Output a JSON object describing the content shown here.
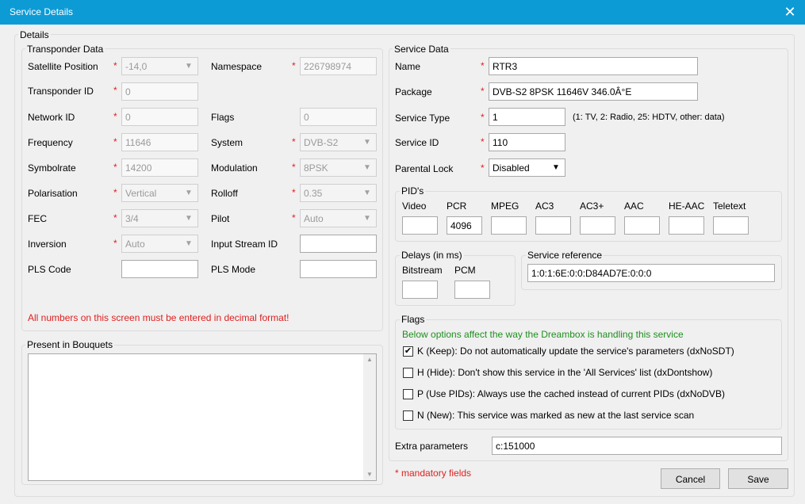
{
  "window": {
    "title": "Service Details"
  },
  "details": {
    "legend": "Details"
  },
  "transponder": {
    "legend": "Transponder Data",
    "satellite_position": {
      "label": "Satellite Position",
      "value": "-14,0"
    },
    "namespace": {
      "label": "Namespace",
      "value": "226798974"
    },
    "transponder_id": {
      "label": "Transponder ID",
      "value": "0"
    },
    "network_id": {
      "label": "Network ID",
      "value": "0"
    },
    "flags": {
      "label": "Flags",
      "value": "0"
    },
    "frequency": {
      "label": "Frequency",
      "value": "11646"
    },
    "system": {
      "label": "System",
      "value": "DVB-S2"
    },
    "symbolrate": {
      "label": "Symbolrate",
      "value": "14200"
    },
    "modulation": {
      "label": "Modulation",
      "value": "8PSK"
    },
    "polarisation": {
      "label": "Polarisation",
      "value": "Vertical"
    },
    "rolloff": {
      "label": "Rolloff",
      "value": "0.35"
    },
    "fec": {
      "label": "FEC",
      "value": "3/4"
    },
    "pilot": {
      "label": "Pilot",
      "value": "Auto"
    },
    "inversion": {
      "label": "Inversion",
      "value": "Auto"
    },
    "input_stream_id": {
      "label": "Input Stream ID",
      "value": ""
    },
    "pls_code": {
      "label": "PLS Code",
      "value": ""
    },
    "pls_mode": {
      "label": "PLS Mode",
      "value": ""
    },
    "warning": "All numbers on this screen must be entered in decimal format!"
  },
  "bouquets": {
    "legend": "Present in Bouquets"
  },
  "service": {
    "legend": "Service Data",
    "name": {
      "label": "Name",
      "value": "RTR3"
    },
    "package": {
      "label": "Package",
      "value": "DVB-S2 8PSK 11646V 346.0Â°E"
    },
    "service_type": {
      "label": "Service Type",
      "value": "1",
      "hint": "(1: TV, 2: Radio, 25: HDTV, other: data)"
    },
    "service_id": {
      "label": "Service ID",
      "value": "110"
    },
    "parental_lock": {
      "label": "Parental Lock",
      "value": "Disabled"
    },
    "pids": {
      "legend": "PID's",
      "columns": [
        {
          "label": "Video",
          "value": ""
        },
        {
          "label": "PCR",
          "value": "4096"
        },
        {
          "label": "MPEG",
          "value": ""
        },
        {
          "label": "AC3",
          "value": ""
        },
        {
          "label": "AC3+",
          "value": ""
        },
        {
          "label": "AAC",
          "value": ""
        },
        {
          "label": "HE-AAC",
          "value": ""
        },
        {
          "label": "Teletext",
          "value": ""
        }
      ]
    },
    "delays": {
      "legend": "Delays (in ms)",
      "bitstream": {
        "label": "Bitstream",
        "value": ""
      },
      "pcm": {
        "label": "PCM",
        "value": ""
      }
    },
    "reference": {
      "legend": "Service reference",
      "value": "1:0:1:6E:0:0:D84AD7E:0:0:0"
    },
    "flags": {
      "legend": "Flags",
      "note": "Below options affect the way the Dreambox is handling this service",
      "items": [
        {
          "label": "K (Keep): Do not automatically update the service's parameters (dxNoSDT)",
          "checked": true
        },
        {
          "label": "H (Hide): Don't show this service in the 'All Services' list (dxDontshow)",
          "checked": false
        },
        {
          "label": "P (Use PIDs): Always use the cached instead of current PIDs (dxNoDVB)",
          "checked": false
        },
        {
          "label": "N (New): This service was marked as new at the last service scan",
          "checked": false
        }
      ]
    },
    "extra": {
      "label": "Extra parameters",
      "value": "c:151000"
    }
  },
  "footer": {
    "mandatory": "* mandatory fields",
    "cancel_label": "Cancel",
    "save_label": "Save"
  },
  "asterisk": "*",
  "icons": {
    "close": "close-icon",
    "dropdown": "chevron-down-icon",
    "check": "checkmark-icon"
  },
  "colors": {
    "titlebar": "#0d9bd6",
    "mandatory": "#e02020",
    "note": "#1f8f1f"
  }
}
